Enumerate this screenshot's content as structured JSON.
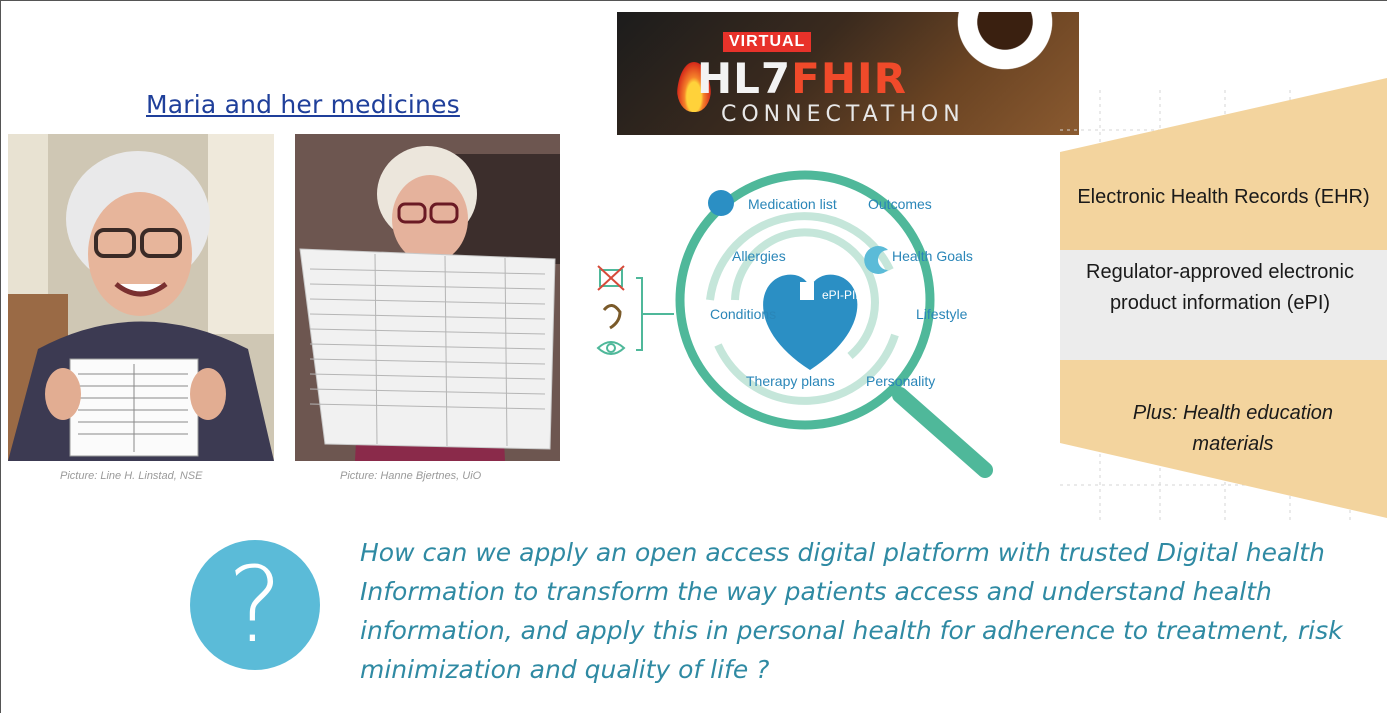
{
  "title": "Maria and her medicines",
  "captions": {
    "left": "Picture: Line H. Linstad, NSE",
    "right": "Picture: Hanne Bjertnes, UiO"
  },
  "banner": {
    "badge": "VIRTUAL",
    "logo_left": "HL7",
    "logo_right": "FHIR",
    "subtitle": "CONNECTATHON"
  },
  "diagram": {
    "center": "ePI-PIL",
    "labels": {
      "medication_list": "Medication list",
      "outcomes": "Outcomes",
      "allergies": "Allergies",
      "health_goals": "Health Goals",
      "conditions": "Conditions",
      "lifestyle": "Lifestyle",
      "therapy_plans": "Therapy plans",
      "personality": "Personality"
    },
    "colors": {
      "ring": "#4fb89a",
      "label": "#2a86b8",
      "heart": "#2b8fc4"
    }
  },
  "panel": {
    "ehr": "Electronic Health Records (EHR)",
    "epi": "Regulator-approved electronic product information (ePI)",
    "plus": "Plus: Health education materials",
    "colors": {
      "band": "#f3d49e",
      "grey": "#ececec"
    }
  },
  "question": {
    "icon": "question-mark-icon",
    "symbol": "?",
    "text": "How can we apply an open access digital platform with trusted Digital health Information to transform the way patients access and understand health information, and apply this in personal health for adherence to treatment, risk minimization and quality of life ?"
  }
}
